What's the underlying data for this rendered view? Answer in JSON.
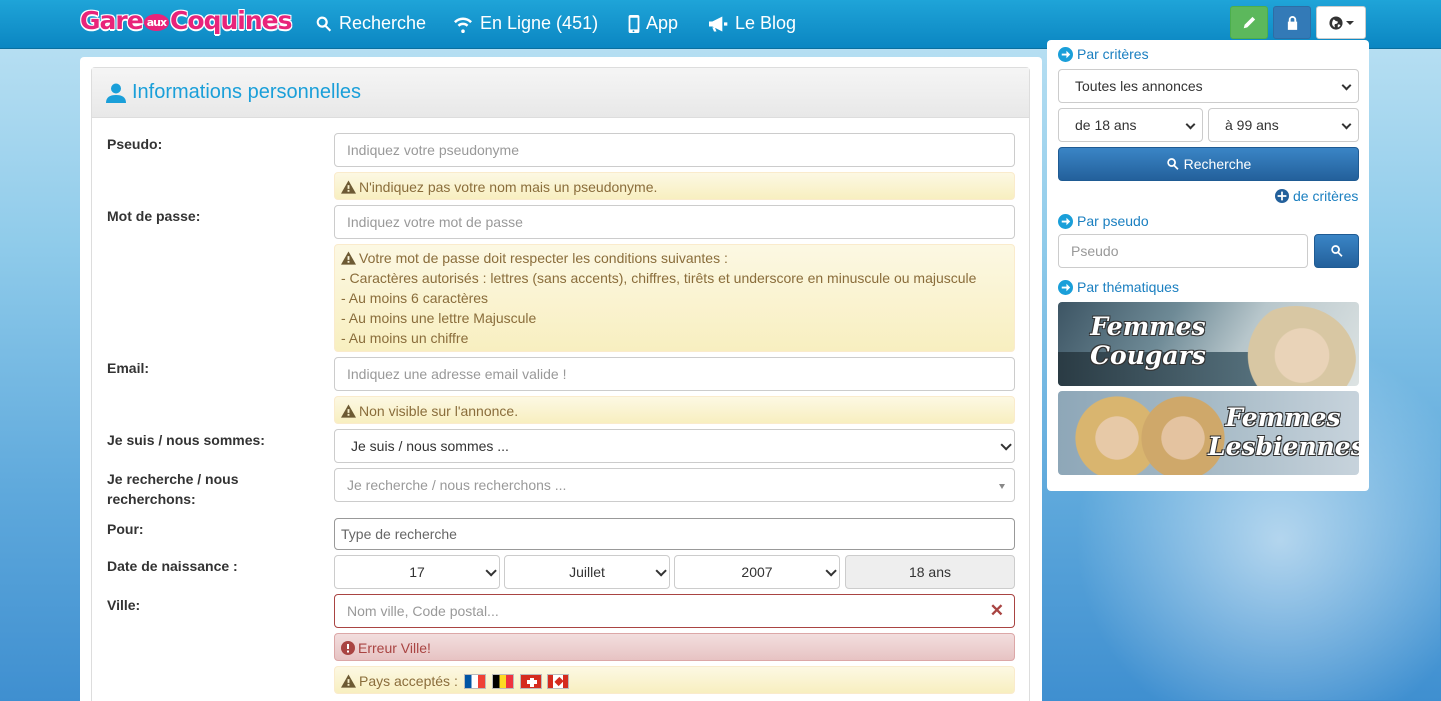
{
  "brand": {
    "part1": "Gare",
    "aux": "aux",
    "part2": "Coquines"
  },
  "nav": {
    "search": "Recherche",
    "online": "En Ligne (451)",
    "app": "App",
    "blog": "Le Blog"
  },
  "panel": {
    "title": "Informations personnelles"
  },
  "form": {
    "pseudo": {
      "label": "Pseudo:",
      "placeholder": "Indiquez votre pseudonyme",
      "hint": "N'indiquez pas votre nom mais un pseudonyme."
    },
    "password": {
      "label": "Mot de passe:",
      "placeholder": "Indiquez votre mot de passe",
      "rules": [
        "Votre mot de passe doit respecter les conditions suivantes :",
        "- Caractères autorisés : lettres (sans accents), chiffres, tirêts et underscore en minuscule ou majuscule",
        "- Au moins 6 caractères",
        "- Au moins une lettre Majuscule",
        "- Au moins un chiffre"
      ]
    },
    "email": {
      "label": "Email:",
      "placeholder": "Indiquez une adresse email valide !",
      "hint": "Non visible sur l'annonce."
    },
    "iam": {
      "label": "Je suis / nous sommes:",
      "value": "Je suis / nous sommes ..."
    },
    "seek": {
      "label": "Je recherche / nous recherchons:",
      "placeholder": "Je recherche / nous recherchons ..."
    },
    "for": {
      "label": "Pour:",
      "placeholder": "Type de recherche"
    },
    "birth": {
      "label": "Date de naissance :",
      "day": "17",
      "month": "Juillet",
      "year": "2007",
      "age": "18 ans"
    },
    "city": {
      "label": "Ville:",
      "placeholder": "Nom ville, Code postal...",
      "error": "Erreur Ville!",
      "countries": "Pays acceptés :"
    }
  },
  "sidebar": {
    "by_criteria": "Par critères",
    "ads_select": "Toutes les annonces",
    "age_from": "de 18 ans",
    "age_to": "à 99 ans",
    "search_button": "Recherche",
    "more_criteria": "de critères",
    "by_pseudo": "Par pseudo",
    "pseudo_placeholder": "Pseudo",
    "by_theme": "Par thématiques",
    "banner1": {
      "line1": "Femmes",
      "line2": "Cougars"
    },
    "banner2": {
      "line1": "Femmes",
      "line2": "Lesbiennes"
    }
  },
  "colors": {
    "accent": "#1a9fd9",
    "navbar": "#0b86c2",
    "warning_bg": "#fcf8e3",
    "error_bg": "#f2dede",
    "green": "#5cb85c",
    "primary": "#337ab7"
  }
}
